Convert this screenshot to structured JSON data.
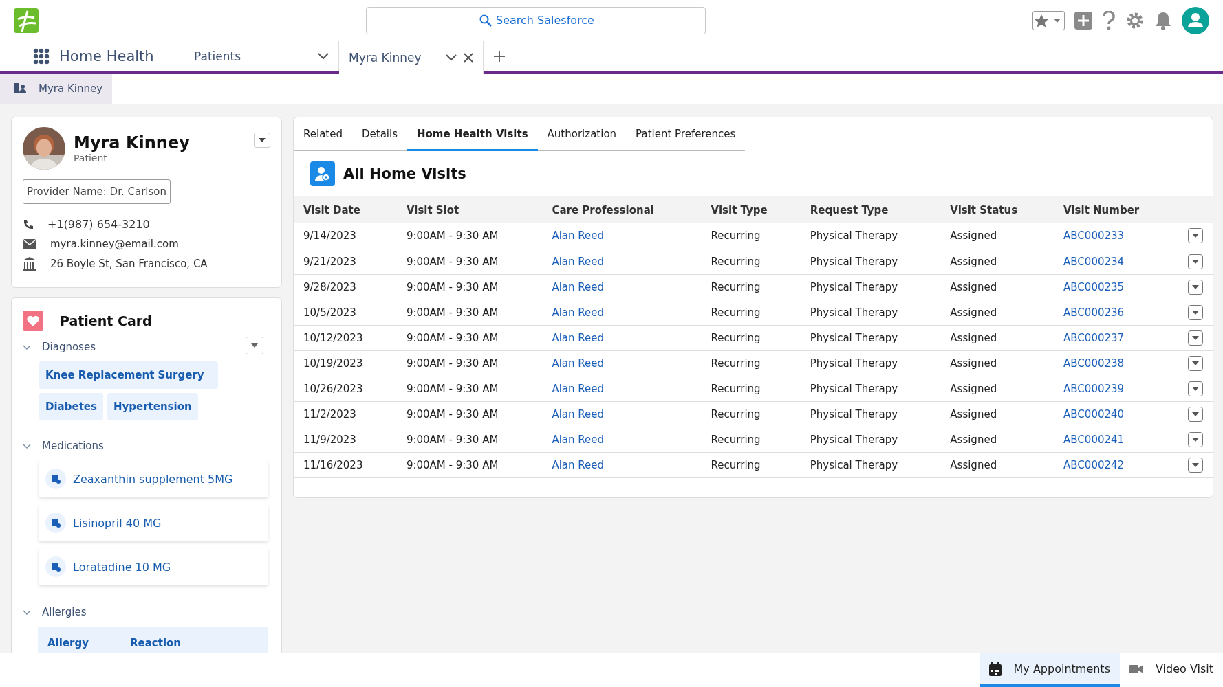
{
  "app_name": "Home Health",
  "search": {
    "placeholder": "Search Salesforce"
  },
  "nav_tabs": [
    {
      "label": "Patients",
      "selected": false,
      "closable": false
    },
    {
      "label": "Myra Kinney",
      "selected": true,
      "closable": true
    }
  ],
  "breadcrumb": "Myra Kinney",
  "patient": {
    "name": "Myra Kinney",
    "role": "Patient",
    "provider": "Provider Name: Dr. Carlson",
    "phone": "+1(987) 654-3210",
    "email": "myra.kinney@email.com",
    "address": "26 Boyle St, San Francisco, CA"
  },
  "patient_card": {
    "title": "Patient Card",
    "diagnoses": {
      "label": "Diagnoses",
      "expanded": true,
      "items": [
        "Knee Replacement Surgery",
        "Diabetes",
        "Hypertension"
      ]
    },
    "medications": {
      "label": "Medications",
      "expanded": true,
      "items": [
        "Zeaxanthin supplement 5MG",
        "Lisinopril 40 MG",
        "Loratadine 10 MG"
      ]
    },
    "allergies": {
      "label": "Allergies",
      "expanded": true,
      "columns": [
        "Allergy",
        "Reaction"
      ]
    }
  },
  "record_tabs": [
    {
      "label": "Related",
      "selected": false
    },
    {
      "label": "Details",
      "selected": false
    },
    {
      "label": "Home Health Visits",
      "selected": true
    },
    {
      "label": "Authorization",
      "selected": false
    },
    {
      "label": "Patient Preferences",
      "selected": false
    }
  ],
  "visits": {
    "title": "All Home Visits",
    "columns": [
      {
        "label": "Visit Date",
        "kind": "text"
      },
      {
        "label": "Visit Slot",
        "kind": "text"
      },
      {
        "label": "Care Professional",
        "kind": "link"
      },
      {
        "label": "Visit Type",
        "kind": "text"
      },
      {
        "label": "Request Type",
        "kind": "text"
      },
      {
        "label": "Visit Status",
        "kind": "text"
      },
      {
        "label": "Visit Number",
        "kind": "link"
      }
    ],
    "rows": [
      [
        "9/14/2023",
        "9:00AM - 9:30 AM",
        "Alan Reed",
        "Recurring",
        "Physical Therapy",
        "Assigned",
        "ABC000233"
      ],
      [
        "9/21/2023",
        "9:00AM - 9:30 AM",
        "Alan Reed",
        "Recurring",
        "Physical Therapy",
        "Assigned",
        "ABC000234"
      ],
      [
        "9/28/2023",
        "9:00AM - 9:30 AM",
        "Alan Reed",
        "Recurring",
        "Physical Therapy",
        "Assigned",
        "ABC000235"
      ],
      [
        "10/5/2023",
        "9:00AM - 9:30 AM",
        "Alan Reed",
        "Recurring",
        "Physical Therapy",
        "Assigned",
        "ABC000236"
      ],
      [
        "10/12/2023",
        "9:00AM - 9:30 AM",
        "Alan Reed",
        "Recurring",
        "Physical Therapy",
        "Assigned",
        "ABC000237"
      ],
      [
        "10/19/2023",
        "9:00AM - 9:30 AM",
        "Alan Reed",
        "Recurring",
        "Physical Therapy",
        "Assigned",
        "ABC000238"
      ],
      [
        "10/26/2023",
        "9:00AM - 9:30 AM",
        "Alan Reed",
        "Recurring",
        "Physical Therapy",
        "Assigned",
        "ABC000239"
      ],
      [
        "11/2/2023",
        "9:00AM - 9:30 AM",
        "Alan Reed",
        "Recurring",
        "Physical Therapy",
        "Assigned",
        "ABC000240"
      ],
      [
        "11/9/2023",
        "9:00AM - 9:30 AM",
        "Alan Reed",
        "Recurring",
        "Physical Therapy",
        "Assigned",
        "ABC000241"
      ],
      [
        "11/16/2023",
        "9:00AM - 9:30 AM",
        "Alan Reed",
        "Recurring",
        "Physical Therapy",
        "Assigned",
        "ABC000242"
      ]
    ]
  },
  "utility_bar": [
    {
      "label": "My Appointments",
      "kind": "calendar",
      "selected": true
    },
    {
      "label": "Video Visit",
      "kind": "video",
      "selected": false
    }
  ]
}
